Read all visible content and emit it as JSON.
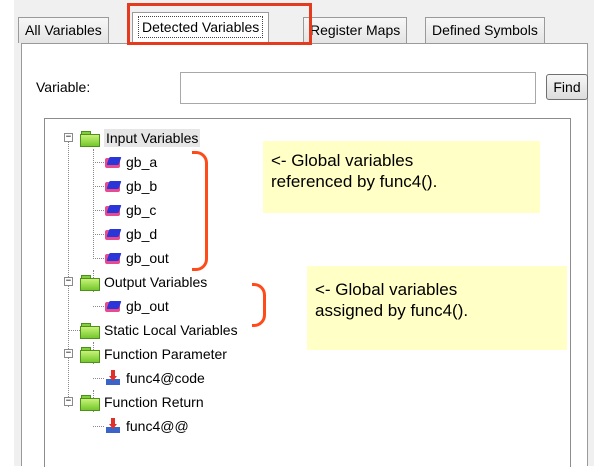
{
  "tabs": [
    {
      "label": "All Variables"
    },
    {
      "label": "Detected Variables"
    },
    {
      "label": "Register Maps"
    },
    {
      "label": "Defined Symbols"
    }
  ],
  "search": {
    "label": "Variable:",
    "value": "",
    "placeholder": "",
    "find_label": "Find"
  },
  "tree": {
    "input_variables": {
      "label": "Input Variables",
      "items": [
        "gb_a",
        "gb_b",
        "gb_c",
        "gb_d",
        "gb_out"
      ]
    },
    "output_variables": {
      "label": "Output Variables",
      "items": [
        "gb_out"
      ]
    },
    "static_local": {
      "label": "Static Local Variables"
    },
    "function_parameter": {
      "label": "Function Parameter",
      "items": [
        "func4@code"
      ]
    },
    "function_return": {
      "label": "Function Return",
      "items": [
        "func4@@"
      ]
    }
  },
  "annotations": {
    "input_note": "<- Global variables\nreferenced by func4().",
    "output_note": "<- Global variables\nassigned by func4()."
  },
  "colors": {
    "highlight": "#e53a1e",
    "bracket": "#ff4a1a",
    "note_background": "#ffffc6"
  },
  "icons": {
    "folder": "folder-icon",
    "variable": "variable-icon",
    "parameter": "parameter-icon",
    "expander": "collapse-icon"
  }
}
